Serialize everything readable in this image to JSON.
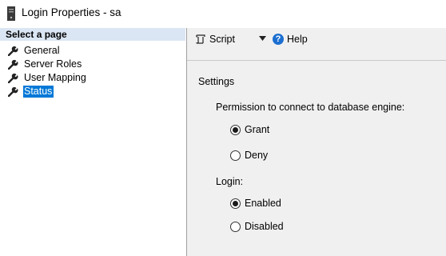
{
  "window": {
    "title": "Login Properties - sa"
  },
  "sidebar": {
    "header": "Select a page",
    "items": [
      {
        "label": "General",
        "selected": false
      },
      {
        "label": "Server Roles",
        "selected": false
      },
      {
        "label": "User Mapping",
        "selected": false
      },
      {
        "label": "Status",
        "selected": true
      }
    ]
  },
  "toolbar": {
    "script_label": "Script",
    "help_label": "Help"
  },
  "settings": {
    "title": "Settings",
    "permission_label": "Permission to connect to database engine:",
    "permission_options": [
      {
        "label": "Grant",
        "checked": true
      },
      {
        "label": "Deny",
        "checked": false
      }
    ],
    "login_label": "Login:",
    "login_options": [
      {
        "label": "Enabled",
        "checked": true
      },
      {
        "label": "Disabled",
        "checked": false
      }
    ]
  },
  "colors": {
    "selection": "#0078d7",
    "header_bg": "#dbe6f4",
    "pane_bg": "#f0f0f0"
  }
}
